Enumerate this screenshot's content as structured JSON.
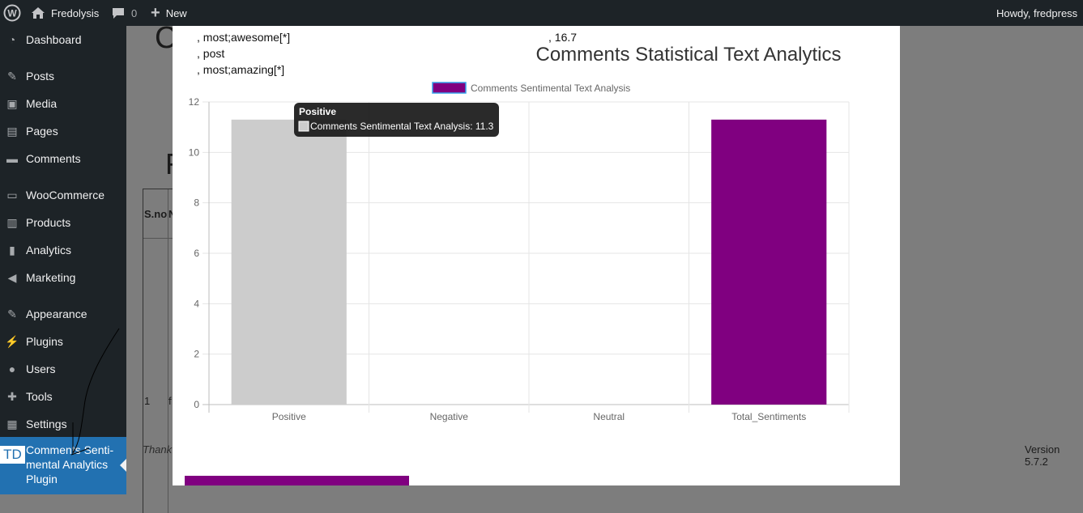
{
  "admin_bar": {
    "site_name": "Fredolysis",
    "comments_count": "0",
    "new_label": "New",
    "greeting": "Howdy, fredpress"
  },
  "sidebar": {
    "items": [
      {
        "label": "Dashboard",
        "icon": "dashboard-icon"
      },
      {
        "label": "Posts",
        "icon": "pin-icon"
      },
      {
        "label": "Media",
        "icon": "media-icon"
      },
      {
        "label": "Pages",
        "icon": "pages-icon"
      },
      {
        "label": "Comments",
        "icon": "comment-icon"
      },
      {
        "label": "WooCommerce",
        "icon": "woo-icon"
      },
      {
        "label": "Products",
        "icon": "archive-icon"
      },
      {
        "label": "Analytics",
        "icon": "bar-chart-icon"
      },
      {
        "label": "Marketing",
        "icon": "megaphone-icon"
      },
      {
        "label": "Appearance",
        "icon": "brush-icon"
      },
      {
        "label": "Plugins",
        "icon": "plug-icon"
      },
      {
        "label": "Users",
        "icon": "user-icon"
      },
      {
        "label": "Tools",
        "icon": "wrench-icon"
      },
      {
        "label": "Settings",
        "icon": "settings-icon"
      }
    ],
    "active_item": {
      "badge": "TD",
      "label_lines": [
        "Comments Senti-",
        "mental Analytics",
        "Plugin"
      ]
    }
  },
  "background_page": {
    "heading_c": "C",
    "heading_f": "F",
    "table_header": "S.no",
    "table_header_partial": "N",
    "row_number": "1",
    "row_partial": "f",
    "footer_thanks": "Thank",
    "version": "Version 5.7.2"
  },
  "modal": {
    "text_lines": [
      ", most;awesome[*]",
      ", post",
      ", most;amazing[*]"
    ],
    "score_text": ", 16.7"
  },
  "tooltip": {
    "title": "Positive",
    "body": "Comments Sentimental Text Analysis: 11.3"
  },
  "colors": {
    "admin_bar": "#1d2327",
    "menu_active": "#2271b1",
    "series_primary": "#800080",
    "series_positive": "#cccccc"
  },
  "chart_data": {
    "type": "bar",
    "title": "Comments Statistical Text Analytics",
    "categories": [
      "Positive",
      "Negative",
      "Neutral",
      "Total_Sentiments"
    ],
    "series": [
      {
        "name": "Comments Sentimental Text Analysis",
        "values": [
          11.3,
          0,
          0,
          11.3
        ],
        "colors": [
          "#cccccc",
          "#800080",
          "#800080",
          "#800080"
        ]
      }
    ],
    "ylim": [
      0,
      12
    ],
    "yticks": [
      "0",
      "2",
      "4",
      "6",
      "8",
      "10",
      "12"
    ],
    "grid": true,
    "legend": "top"
  }
}
